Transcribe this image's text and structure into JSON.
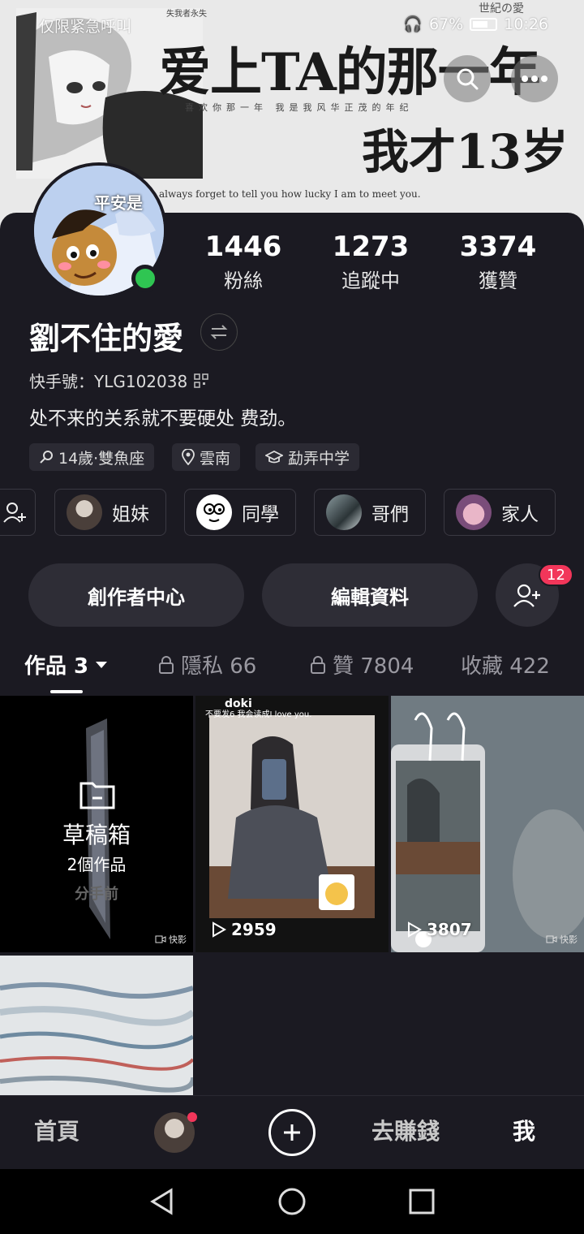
{
  "status_bar": {
    "carrier": "仅限紧急呼叫",
    "battery": "67%",
    "time": "10:26"
  },
  "cover": {
    "tiny_top": "失我者永失",
    "corner_text": "世紀の愛",
    "headline": "爱上TA的那一年",
    "subline": "喜欢你那一年  我是我风华正茂的年纪",
    "headline2": "我才13岁",
    "motto": "always forget to tell you how lucky I am to meet you.",
    "avatar_caption": "平安是"
  },
  "profile": {
    "stats": [
      {
        "value": "1446",
        "label": "粉絲"
      },
      {
        "value": "1273",
        "label": "追蹤中"
      },
      {
        "value": "3374",
        "label": "獲贊"
      }
    ],
    "name": "劉不住的愛",
    "kuaishou_id": "快手號：YLG102038",
    "bio": "处不来的关系就不要硬处 费劲。",
    "tags": [
      "14歲·雙魚座",
      "雲南",
      "勐弄中学"
    ],
    "groups": [
      "姐妹",
      "同學",
      "哥們",
      "家人"
    ],
    "buttons": {
      "creator_center": "創作者中心",
      "edit_profile": "編輯資料"
    },
    "friend_badge": "12"
  },
  "tabs": [
    {
      "label": "作品 3"
    },
    {
      "label": "隱私 66"
    },
    {
      "label": "贊 7804"
    },
    {
      "label": "收藏 422"
    }
  ],
  "grid": {
    "draft": {
      "title": "草稿箱",
      "count": "2個作品",
      "caption": "分手前"
    },
    "post1": {
      "overlay_top": "doki",
      "overlay_caption": "不要发6 我会读成I love you.",
      "views": "2959"
    },
    "post2": {
      "views": "3807"
    },
    "watermark": "快影"
  },
  "bottom_nav": {
    "home": "首頁",
    "earn": "去賺錢",
    "me": "我"
  },
  "colors": {
    "background": "#1b1a22",
    "online": "#2fc552",
    "badge": "#f2365a"
  }
}
